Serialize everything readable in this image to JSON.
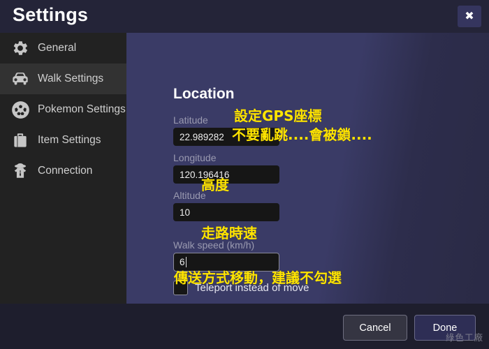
{
  "window": {
    "title": "Settings",
    "close_label": "✖",
    "close_icon": "close-icon"
  },
  "sidebar": {
    "items": [
      {
        "label": "General",
        "icon": "gear-icon",
        "active": false
      },
      {
        "label": "Walk Settings",
        "icon": "car-icon",
        "active": true
      },
      {
        "label": "Pokemon Settings",
        "icon": "pokeball-icon",
        "active": false
      },
      {
        "label": "Item Settings",
        "icon": "briefcase-icon",
        "active": false
      },
      {
        "label": "Connection",
        "icon": "spy-icon",
        "active": false
      }
    ]
  },
  "main": {
    "section_title": "Location",
    "fields": [
      {
        "label": "Latitude",
        "value": "22.989282",
        "focused": false
      },
      {
        "label": "Longitude",
        "value": "120.196416",
        "focused": false
      },
      {
        "label": "Altitude",
        "value": "10",
        "focused": false
      },
      {
        "label": "Walk speed (km/h)",
        "value": "6",
        "focused": true
      }
    ],
    "teleport": {
      "label": "Teleport instead of move",
      "checked": false
    }
  },
  "annotations": [
    {
      "text": "設定GPS座標"
    },
    {
      "text": "不要亂跳....會被鎖...."
    },
    {
      "text": "高度"
    },
    {
      "text": "走路時速"
    },
    {
      "text": "傳送方式移動，建議不勾選"
    }
  ],
  "footer": {
    "cancel_label": "Cancel",
    "done_label": "Done"
  },
  "watermark": "綠色工廠",
  "colors": {
    "titlebar": "#242438",
    "sidebar": "#222222",
    "sidebar_active": "#323232",
    "panel": "#3a3b66",
    "input_bg": "#161616",
    "annotation": "#ffe400",
    "done_button": "#2e2e55"
  }
}
